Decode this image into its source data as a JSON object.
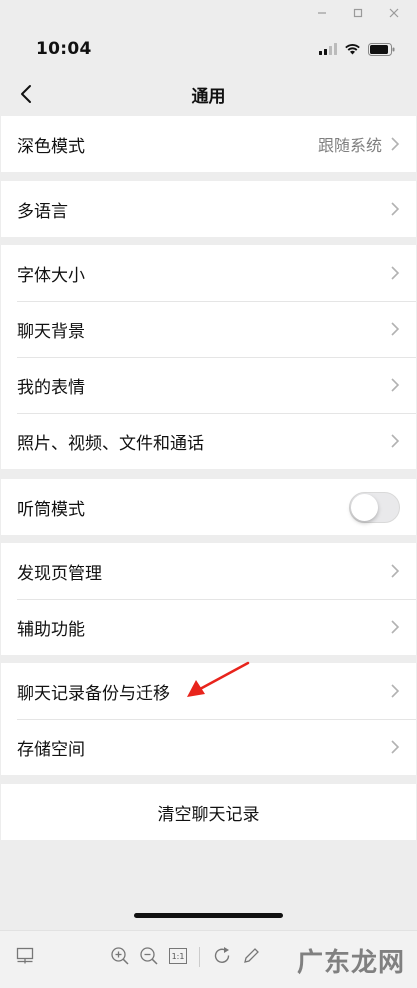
{
  "status_bar": {
    "time": "10:04"
  },
  "nav": {
    "title": "通用"
  },
  "groups": [
    {
      "rows": [
        {
          "label": "深色模式",
          "value": "跟随系统"
        }
      ]
    },
    {
      "rows": [
        {
          "label": "多语言"
        }
      ]
    },
    {
      "rows": [
        {
          "label": "字体大小"
        },
        {
          "label": "聊天背景"
        },
        {
          "label": "我的表情"
        },
        {
          "label": "照片、视频、文件和通话"
        }
      ]
    },
    {
      "rows": [
        {
          "label": "听筒模式",
          "toggle": false
        }
      ]
    },
    {
      "rows": [
        {
          "label": "发现页管理"
        },
        {
          "label": "辅助功能"
        }
      ]
    },
    {
      "rows": [
        {
          "label": "聊天记录备份与迁移"
        },
        {
          "label": "存储空间"
        }
      ]
    }
  ],
  "clear_history": {
    "label": "清空聊天记录"
  },
  "annotation": {
    "arrow_color": "#e8241c",
    "target": "聊天记录备份与迁移"
  },
  "watermark": {
    "text": "广东龙网"
  },
  "toolbar": {
    "icons": [
      "layout-icon",
      "zoom-in-icon",
      "zoom-out-icon",
      "actual-size-icon",
      "rotate-icon",
      "edit-icon"
    ],
    "actual_size_label": "1:1"
  }
}
